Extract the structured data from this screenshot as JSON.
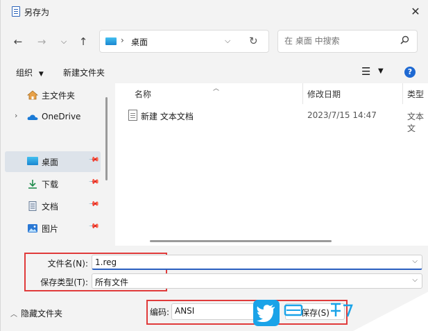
{
  "window": {
    "title": "另存为"
  },
  "address": {
    "location": "桌面"
  },
  "search": {
    "placeholder": "在 桌面 中搜索"
  },
  "toolbar": {
    "organize": "组织",
    "new_folder": "新建文件夹"
  },
  "nav": {
    "items": [
      {
        "label": "主文件夹",
        "icon": "home-icon"
      },
      {
        "label": "OneDrive",
        "icon": "cloud-icon"
      },
      {
        "label": "桌面",
        "icon": "desktop-icon",
        "pinned": true,
        "selected": true
      },
      {
        "label": "下载",
        "icon": "download-icon",
        "pinned": true
      },
      {
        "label": "文档",
        "icon": "document-icon",
        "pinned": true
      },
      {
        "label": "图片",
        "icon": "picture-icon",
        "pinned": true
      }
    ]
  },
  "files": {
    "columns": {
      "name": "名称",
      "date": "修改日期",
      "type": "类型"
    },
    "rows": [
      {
        "name": "新建 文本文档",
        "date": "2023/7/15 14:47",
        "type": "文本文"
      }
    ]
  },
  "form": {
    "filename_label": "文件名(N):",
    "filename_value": "1.reg",
    "filetype_label": "保存类型(T):",
    "filetype_value": "所有文件",
    "hide_folders": "隐藏文件夹",
    "encoding_label": "编码:",
    "encoding_value": "ANSI",
    "save_button": "保存(S)"
  },
  "colors": {
    "accent": "#1e69d2",
    "highlight_frame": "#e03a3a",
    "watermark": "#1aa3e8"
  }
}
